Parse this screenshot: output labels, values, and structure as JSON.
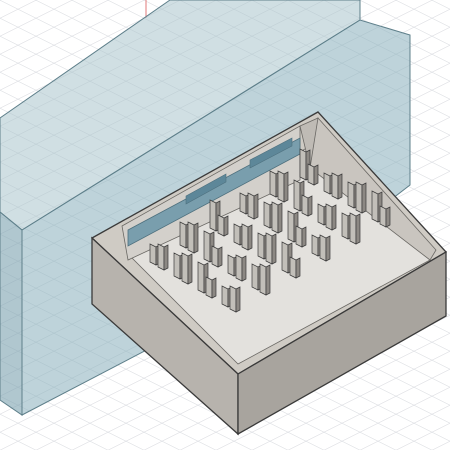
{
  "viewport": {
    "name": "3d-model-viewport",
    "background_color": "#ffffff",
    "grid_color": "#c9cdd3",
    "axis_color": "#e07a7a"
  },
  "model": {
    "transparent_body": {
      "face_color": "#8fb3bf",
      "edge_color": "#5e7f8a"
    },
    "tray": {
      "front_color": "#b7b3ad",
      "side_color": "#a8a49e",
      "top_color": "#cfcbc4",
      "floor_color": "#e3e1dd",
      "inner_wall_color": "#d3d0cb",
      "edge_color": "#3a3a3a"
    },
    "slots": {
      "color": "#6f98aa"
    },
    "pins": {
      "face_color": "#c2bfb9",
      "dark_color": "#8c8883"
    }
  }
}
